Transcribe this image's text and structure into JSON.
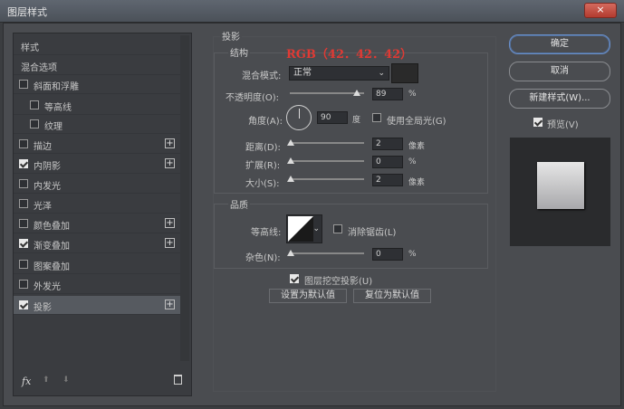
{
  "window": {
    "title": "图层样式",
    "close": "×"
  },
  "left_panel": {
    "items": [
      {
        "label": "样式",
        "checkbox": false,
        "plus": false
      },
      {
        "label": "混合选项",
        "checkbox": false,
        "plus": false
      },
      {
        "label": "斜面和浮雕",
        "checkbox": true,
        "checked": false,
        "plus": false
      },
      {
        "label": "等高线",
        "checkbox": true,
        "checked": false,
        "plus": false,
        "indent": true
      },
      {
        "label": "纹理",
        "checkbox": true,
        "checked": false,
        "plus": false,
        "indent": true
      },
      {
        "label": "描边",
        "checkbox": true,
        "checked": false,
        "plus": true
      },
      {
        "label": "内阴影",
        "checkbox": true,
        "checked": true,
        "plus": true
      },
      {
        "label": "内发光",
        "checkbox": true,
        "checked": false,
        "plus": false
      },
      {
        "label": "光泽",
        "checkbox": true,
        "checked": false,
        "plus": false
      },
      {
        "label": "颜色叠加",
        "checkbox": true,
        "checked": false,
        "plus": true
      },
      {
        "label": "渐变叠加",
        "checkbox": true,
        "checked": true,
        "plus": true
      },
      {
        "label": "图案叠加",
        "checkbox": true,
        "checked": false,
        "plus": false
      },
      {
        "label": "外发光",
        "checkbox": true,
        "checked": false,
        "plus": false
      },
      {
        "label": "投影",
        "checkbox": true,
        "checked": true,
        "plus": true,
        "selected": true
      }
    ],
    "footer": {
      "fx": "fx",
      "up": "⬆",
      "down": "⬇",
      "trash": "🗑"
    }
  },
  "shadow": {
    "section_title": "投影",
    "structure_title": "结构",
    "annotation": "RGB（42．42．42）",
    "blend_mode_label": "混合模式:",
    "blend_mode_value": "正常",
    "swatch_color": "#2a2a2a",
    "opacity_label": "不透明度(O):",
    "opacity_value": "89",
    "opacity_unit": "%",
    "angle_label": "角度(A):",
    "angle_value": "90",
    "angle_unit": "度",
    "global_light_label": "使用全局光(G)",
    "distance_label": "距离(D):",
    "distance_value": "2",
    "distance_unit": "像素",
    "spread_label": "扩展(R):",
    "spread_value": "0",
    "spread_unit": "%",
    "size_label": "大小(S):",
    "size_value": "2",
    "size_unit": "像素",
    "quality_title": "品质",
    "contour_label": "等高线:",
    "antialias_label": "消除锯齿(L)",
    "noise_label": "杂色(N):",
    "noise_value": "0",
    "noise_unit": "%",
    "knockout_label": "图层挖空投影(U)",
    "default_btn": "设置为默认值",
    "reset_btn": "复位为默认值"
  },
  "right": {
    "ok": "确定",
    "cancel": "取消",
    "new_style": "新建样式(W)...",
    "preview_label": "预览(V)"
  }
}
